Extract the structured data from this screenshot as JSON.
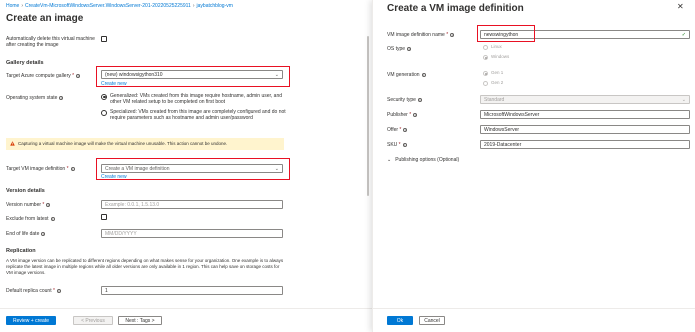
{
  "breadcrumb": [
    "Home",
    "CreateVm-MicrosoftWindowsServer.WindowsServer-201-20220525225911",
    "jaybatchblog-vm"
  ],
  "page_title": "Create an image",
  "auto_delete": {
    "label": "Automatically delete this virtual machine after creating the image"
  },
  "gallery_details": {
    "heading": "Gallery details",
    "target_gallery_label": "Target Azure compute gallery",
    "target_gallery_value": "(new) windowsigython310",
    "create_new": "Create new",
    "os_state_label": "Operating system state",
    "generalized": "Generalized: VMs created from this image require hostname, admin user, and other VM related setup to be completed on first boot",
    "specialized": "Specialized: VMs created from this image are completely configured and do not require parameters such as hostname and admin user/password"
  },
  "warning": "Capturing a virtual machine image will make the virtual machine unusable. This action cannot be undone.",
  "vm_image_definition": {
    "label": "Target VM image definition",
    "placeholder": "Create a VM image definition",
    "create_new": "Create new"
  },
  "version_details": {
    "heading": "Version details",
    "version_number_label": "Version number",
    "version_number_placeholder": "Example: 0.0.1, 1.5.13.0",
    "exclude_latest_label": "Exclude from latest",
    "end_of_life_label": "End of life date",
    "end_of_life_placeholder": "MM/DD/YYYY"
  },
  "replication": {
    "heading": "Replication",
    "description": "A VM image version can be replicated to different regions depending on what makes sense for your organization. One example is to always replicate the latest image in multiple regions while all older versions are only available in 1 region. This can help save on storage costs for VM image versions.",
    "replica_count_label": "Default replica count",
    "replica_count_value": "1"
  },
  "footer": {
    "review_create": "Review + create",
    "previous": "< Previous",
    "next": "Next : Tags >"
  },
  "blade": {
    "title": "Create a VM image definition",
    "close_glyph": "✕",
    "name_label": "VM image definition name",
    "name_value": "newswingython",
    "os_type_label": "OS type",
    "os_linux": "Linux",
    "os_windows": "Windows",
    "vm_gen_label": "VM generation",
    "gen1": "Gen 1",
    "gen2": "Gen 2",
    "security_type_label": "Security type",
    "security_type_value": "Standard",
    "publisher_label": "Publisher",
    "publisher_value": "MicrosoftWindowsServer",
    "offer_label": "Offer",
    "offer_value": "WindowsServer",
    "sku_label": "SKU",
    "sku_value": "2019-Datacenter",
    "publishing_options": "Publishing options (Optional)",
    "ok": "Ok",
    "cancel": "Cancel"
  },
  "colors": {
    "accent": "#0078d4",
    "highlight": "#e81123",
    "warning_bg": "#fff4ce"
  },
  "icons": [
    "info-icon",
    "chevron-down-icon",
    "warning-icon",
    "close-icon",
    "checkmark-icon",
    "chevron-right-icon"
  ]
}
